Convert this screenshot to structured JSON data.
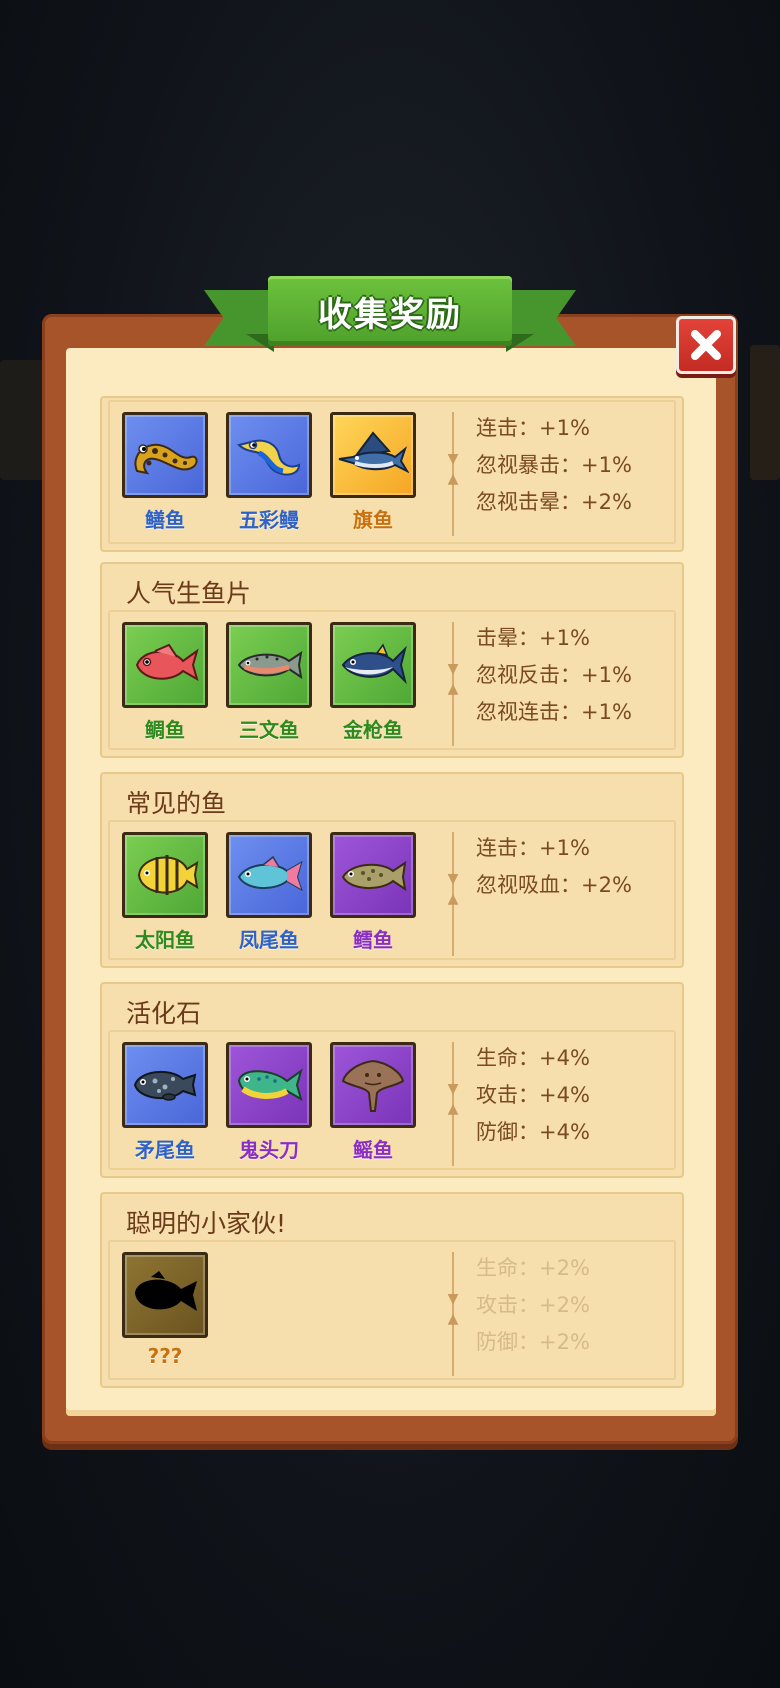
{
  "header": {
    "title": "收集奖励",
    "close_icon": "close-x-icon"
  },
  "colors": {
    "frame": "#a8542b",
    "paper": "#fcebc0",
    "ribbon": "#4ea02b",
    "close": "#d0342b"
  },
  "collections": [
    {
      "title": "",
      "fish": [
        {
          "name": "鳝鱼",
          "rarity": "blue",
          "icon": "spotted-eel-icon"
        },
        {
          "name": "五彩鳗",
          "rarity": "blue",
          "icon": "ribbon-eel-icon"
        },
        {
          "name": "旗鱼",
          "rarity": "gold",
          "icon": "sailfish-icon"
        }
      ],
      "bonuses": [
        "连击：+1%",
        "忽视暴击：+1%",
        "忽视击晕：+2%"
      ]
    },
    {
      "title": "人气生鱼片",
      "fish": [
        {
          "name": "鲷鱼",
          "rarity": "green",
          "icon": "snapper-icon"
        },
        {
          "name": "三文鱼",
          "rarity": "green",
          "icon": "salmon-icon"
        },
        {
          "name": "金枪鱼",
          "rarity": "green",
          "icon": "tuna-icon"
        }
      ],
      "bonuses": [
        "击晕：+1%",
        "忽视反击：+1%",
        "忽视连击：+1%"
      ]
    },
    {
      "title": "常见的鱼",
      "fish": [
        {
          "name": "太阳鱼",
          "rarity": "green",
          "icon": "butterflyfish-icon"
        },
        {
          "name": "凤尾鱼",
          "rarity": "blue",
          "icon": "parrotfish-icon"
        },
        {
          "name": "鳕鱼",
          "rarity": "purple",
          "icon": "cod-icon"
        }
      ],
      "bonuses": [
        "连击：+1%",
        "忽视吸血：+2%"
      ]
    },
    {
      "title": "活化石",
      "fish": [
        {
          "name": "矛尾鱼",
          "rarity": "blue",
          "icon": "coelacanth-icon"
        },
        {
          "name": "鬼头刀",
          "rarity": "purple",
          "icon": "mahi-mahi-icon"
        },
        {
          "name": "鳐鱼",
          "rarity": "purple",
          "icon": "stingray-icon"
        }
      ],
      "bonuses": [
        "生命：+4%",
        "攻击：+4%",
        "防御：+4%"
      ]
    },
    {
      "title": "聪明的小家伙!",
      "fish": [
        {
          "name": "???",
          "rarity": "unknown",
          "icon": "silhouette-fish-icon"
        }
      ],
      "bonuses": [
        "生命：+2%",
        "攻击：+2%",
        "防御：+2%"
      ],
      "locked": true
    }
  ]
}
